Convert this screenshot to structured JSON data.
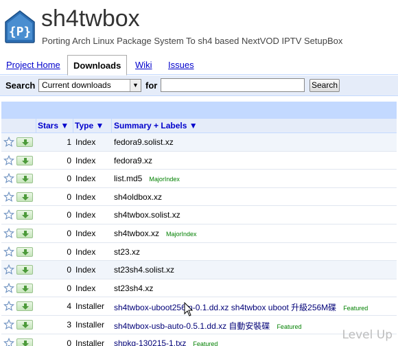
{
  "project": {
    "name": "sh4twbox",
    "summary": "Porting Arch Linux Package System To sh4 based NextVOD IPTV SetupBox",
    "logo_glyph": "{P}"
  },
  "tabs": [
    {
      "label": "Project Home",
      "active": false
    },
    {
      "label": "Downloads",
      "active": true
    },
    {
      "label": "Wiki",
      "active": false
    },
    {
      "label": "Issues",
      "active": false
    }
  ],
  "search": {
    "label": "Search",
    "select_value": "Current downloads",
    "for_label": "for",
    "input_value": "",
    "button_label": "Search"
  },
  "table": {
    "headers": {
      "stars": "Stars ▼",
      "type": "Type ▼",
      "summary": "Summary + Labels ▼"
    },
    "rows": [
      {
        "stars": "1",
        "type": "Index",
        "summary": "fedora9.solist.xz",
        "label": ""
      },
      {
        "stars": "0",
        "type": "Index",
        "summary": "fedora9.xz",
        "label": ""
      },
      {
        "stars": "0",
        "type": "Index",
        "summary": "list.md5",
        "label": "MajorIndex"
      },
      {
        "stars": "0",
        "type": "Index",
        "summary": "sh4oldbox.xz",
        "label": ""
      },
      {
        "stars": "0",
        "type": "Index",
        "summary": "sh4twbox.solist.xz",
        "label": ""
      },
      {
        "stars": "0",
        "type": "Index",
        "summary": "sh4twbox.xz",
        "label": "MajorIndex"
      },
      {
        "stars": "0",
        "type": "Index",
        "summary": "st23.xz",
        "label": ""
      },
      {
        "stars": "0",
        "type": "Index",
        "summary": "st23sh4.solist.xz",
        "label": ""
      },
      {
        "stars": "0",
        "type": "Index",
        "summary": "st23sh4.xz",
        "label": ""
      },
      {
        "stars": "4",
        "type": "Installer",
        "summary": "sh4twbox-uboot256m-0.1.dd.xz sh4twbox uboot 升級256M碟",
        "label": "Featured"
      },
      {
        "stars": "3",
        "type": "Installer",
        "summary": "sh4twbox-usb-auto-0.5.1.dd.xz 自動安裝碟",
        "label": "Featured"
      },
      {
        "stars": "0",
        "type": "Installer",
        "summary": "shpkg-130215-1.txz",
        "label": "Featured"
      }
    ]
  },
  "watermark": "Level Up",
  "colors": {
    "accent_blue": "#c3d9ff",
    "light_blue": "#e5ecf9",
    "link": "#0000cc",
    "label_green": "#008000"
  }
}
